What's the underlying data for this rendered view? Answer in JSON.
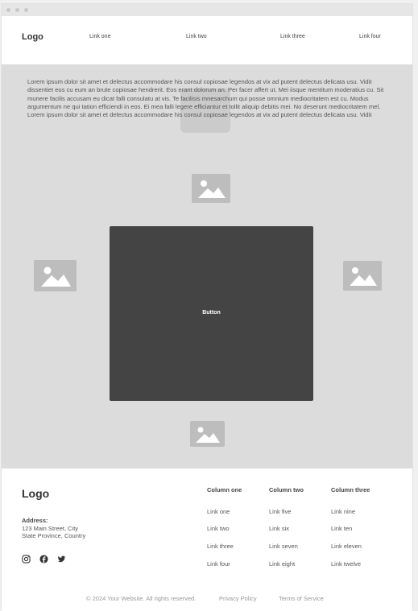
{
  "header": {
    "logo": "Logo",
    "nav_links": [
      "Link one",
      "Link two",
      "Link three",
      "Link four"
    ]
  },
  "hero": {
    "paragraph": "Lorem ipsum dolor sit amet et delectus accommodare his consul copiosae legendos at vix ad putent delectus delicata usu. Vidit dissentiet eos cu eum an brute copiosae hendrerit. Eos erant dolorum an. Per facer affert ut. Mei iisque mentitum moderatius cu. Sit munere facilis accusam eu dicat falli consulatu at vis. Te facilisis mnesarchum qui posse omnium mediocritatem est cu. Modus argumentum ne qui tation efficiendi in eos. Ei mea falli legere efficiantur et tollit aliquip debitis mei. No deserunt mediocritatem mel. Lorem ipsum dolor sit amet et delectus accommodare his consul copiosae legendos at vix ad putent delectus delicata usu. Vidit",
    "button_label": "Button",
    "image_icon": "image-placeholder-icon"
  },
  "footer": {
    "logo": "Logo",
    "address_label": "Address:",
    "address_line1": "123 Main Street, City",
    "address_line2": "State Province, Country",
    "social_icons": [
      "instagram-icon",
      "facebook-icon",
      "twitter-icon"
    ],
    "columns": [
      {
        "title": "Column one",
        "links": [
          "Link one",
          "Link two",
          "Link three",
          "Link four"
        ]
      },
      {
        "title": "Column two",
        "links": [
          "Link five",
          "Link six",
          "Link seven",
          "Link eight"
        ]
      },
      {
        "title": "Column three",
        "links": [
          "Link nine",
          "Link ten",
          "Link eleven",
          "Link twelve"
        ]
      }
    ],
    "copyright": "© 2024 Your Website. All rights reserved.",
    "privacy": "Privacy Policy",
    "terms": "Terms of Service"
  },
  "colors": {
    "hero_bg": "#dcdcdc",
    "dark_panel": "#444444",
    "placeholder": "#bdbdbd"
  }
}
